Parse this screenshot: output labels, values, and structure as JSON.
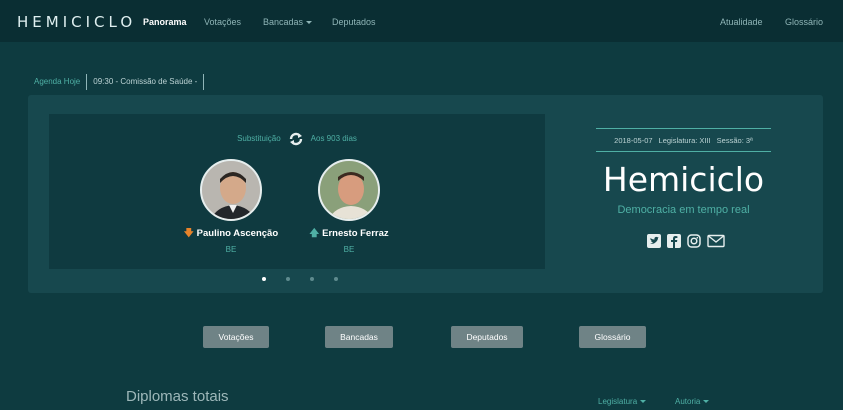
{
  "nav": {
    "brand": "HEMICICLO",
    "links": [
      "Panorama",
      "Votações",
      "Bancadas",
      "Deputados"
    ],
    "right_links": [
      "Atualidade",
      "Glossário"
    ]
  },
  "agenda": {
    "label": "Agenda Hoje",
    "value": "09:30 - Comissão de Saúde -"
  },
  "slide": {
    "type_label": "Substituição",
    "days_label": "Aos 903 dias",
    "outgoing": {
      "name": "Paulino Ascenção",
      "party": "BE"
    },
    "incoming": {
      "name": "Ernesto Ferraz",
      "party": "BE"
    }
  },
  "info": {
    "date": "2018-05-07",
    "legislature": "Legislatura: XIII",
    "session": "Sessão: 3ª"
  },
  "hero": {
    "title": "Hemiciclo",
    "subtitle": "Democracia em tempo real"
  },
  "socials": [
    "twitter-icon",
    "facebook-icon",
    "instagram-icon",
    "mail-icon"
  ],
  "buttons": [
    "Votações",
    "Bancadas",
    "Deputados",
    "Glossário"
  ],
  "section": {
    "title": "Diplomas totais"
  },
  "filters": [
    "Legislatura",
    "Autoria"
  ],
  "carousel": {
    "count": 4,
    "active": 0
  },
  "colors": {
    "background": "#0e3b40",
    "nav": "#0a2e33",
    "accent": "#4fb0a5",
    "down_arrow": "#e8832a",
    "button": "#6f8386"
  }
}
